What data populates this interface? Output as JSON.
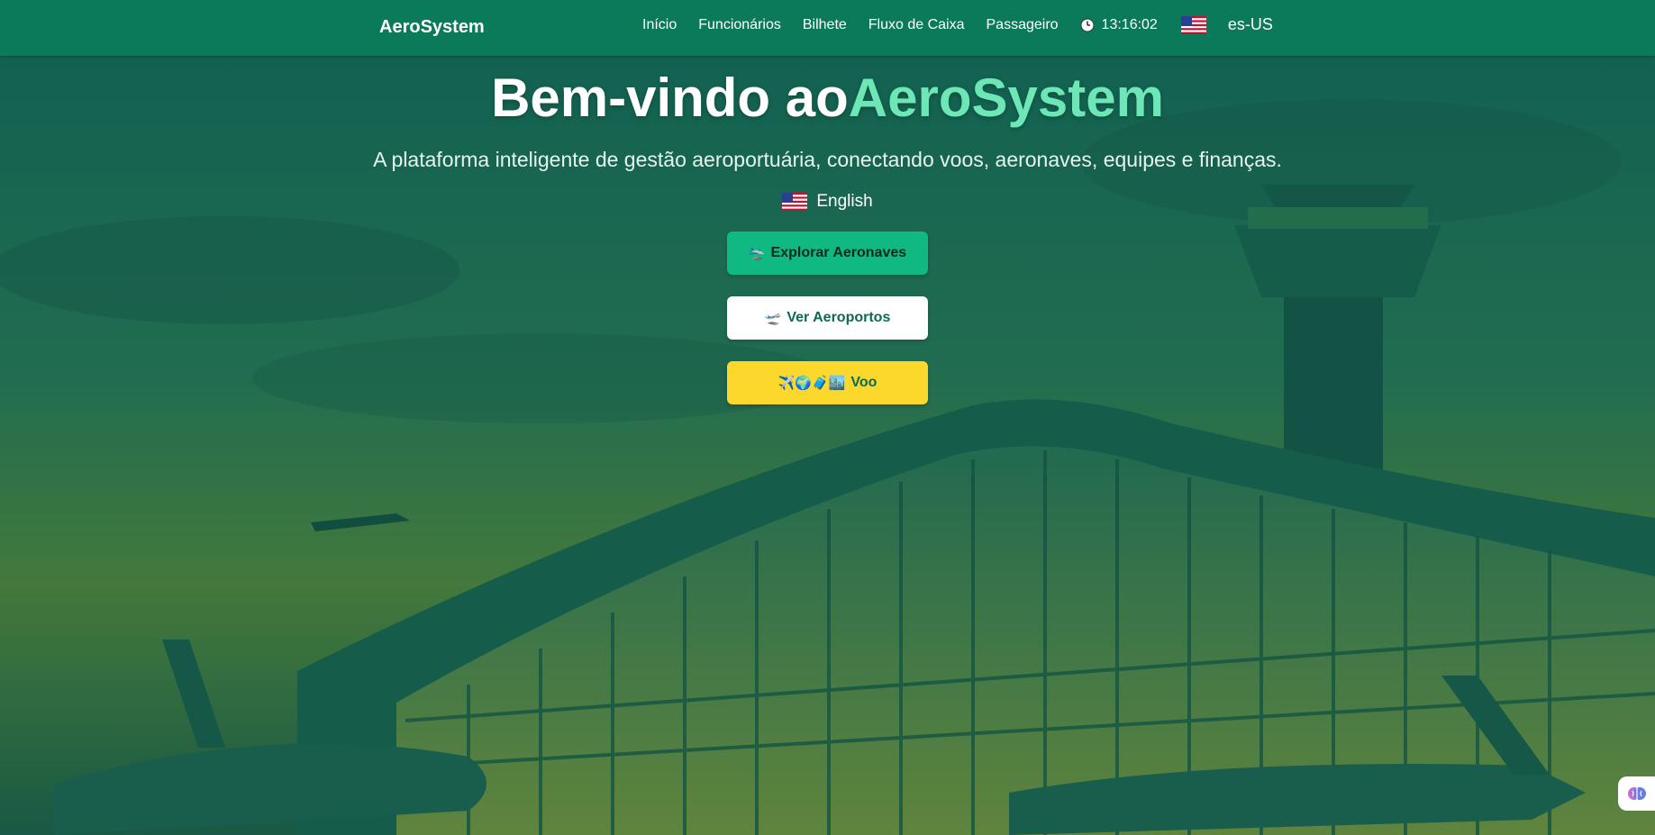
{
  "header": {
    "brand": "AeroSystem",
    "nav": [
      "Início",
      "Funcionários",
      "Bilhete",
      "Fluxo de Caixa",
      "Passageiro"
    ],
    "clock": "13:16:02",
    "clock_icon": "clock-icon",
    "flag_icon": "us-flag-icon",
    "locale": "es-US"
  },
  "hero": {
    "title_prefix": "Bem-vindo ao",
    "title_accent": "AeroSystem",
    "subtitle": "A plataforma inteligente de gestão aeroportuária, conectando voos, aeronaves, equipes e finanças.",
    "language_label": "English",
    "buttons": {
      "explore_icon": "🛬",
      "explore_label": "Explorar Aeronaves",
      "airports_icon": "🛫",
      "airports_label": "Ver Aeroportos",
      "flight_icon": "✈️🌍🧳🏙️",
      "flight_label": "Voo"
    }
  },
  "colors": {
    "topbar": "#0b7a5a",
    "accent": "#6ee7b7",
    "button_green": "#10b981",
    "button_yellow": "#fcd72c"
  },
  "floating": {
    "icon": "brain-icon"
  }
}
